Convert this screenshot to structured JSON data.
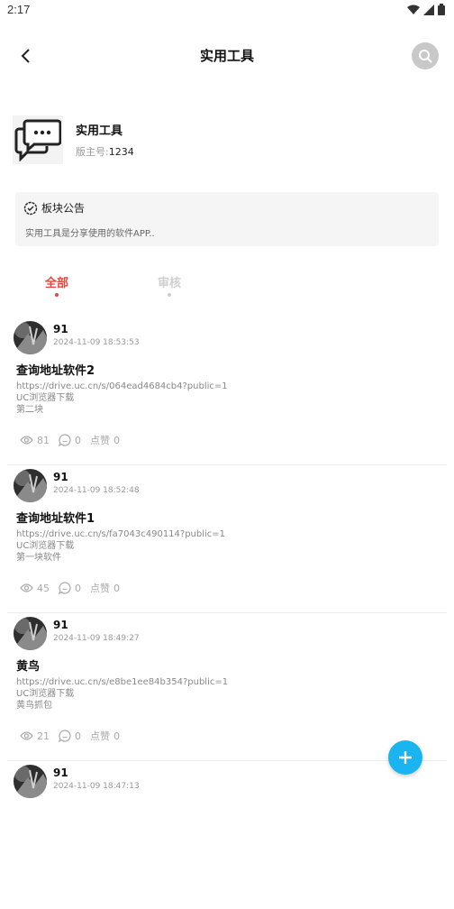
{
  "status_bar": {
    "time": "2:17"
  },
  "app_bar": {
    "title": "实用工具"
  },
  "forum": {
    "name": "实用工具",
    "moderator_label": "版主号:",
    "moderator_value": "1234"
  },
  "notice": {
    "heading": "板块公告",
    "text": "实用工具是分享使用的软件APP.."
  },
  "tabs": [
    {
      "label": "全部",
      "active": true
    },
    {
      "label": "审核",
      "active": false
    }
  ],
  "posts": [
    {
      "username": "91",
      "time": "2024-11-09 18:53:53",
      "title": "查询地址软件2",
      "lines": [
        "https://drive.uc.cn/s/064ead4684cb4?public=1",
        "UC浏览器下载",
        "第二块"
      ],
      "views": "81",
      "comments": "0",
      "like_label": "点赞",
      "likes": "0"
    },
    {
      "username": "91",
      "time": "2024-11-09 18:52:48",
      "title": "查询地址软件1",
      "lines": [
        "https://drive.uc.cn/s/fa7043c490114?public=1",
        "UC浏览器下载",
        "第一块软件"
      ],
      "views": "45",
      "comments": "0",
      "like_label": "点赞",
      "likes": "0"
    },
    {
      "username": "91",
      "time": "2024-11-09 18:49:27",
      "title": "黄鸟",
      "lines": [
        "https://drive.uc.cn/s/e8be1ee84b354?public=1",
        "UC浏览器下载",
        "黄鸟抓包"
      ],
      "views": "21",
      "comments": "0",
      "like_label": "点赞",
      "likes": "0"
    },
    {
      "username": "91",
      "time": "2024-11-09 18:47:13",
      "title": "",
      "lines": [],
      "views": "",
      "comments": "",
      "like_label": "",
      "likes": ""
    }
  ],
  "colors": {
    "accent_red": "#e8463c",
    "fab_blue": "#1ab4f0",
    "muted": "#cfcfcf"
  },
  "icons": {
    "back": "chevron-left-icon",
    "search": "search-icon",
    "fab": "plus-icon",
    "notice": "badge-check-icon",
    "forum": "chat-bubbles-icon"
  }
}
